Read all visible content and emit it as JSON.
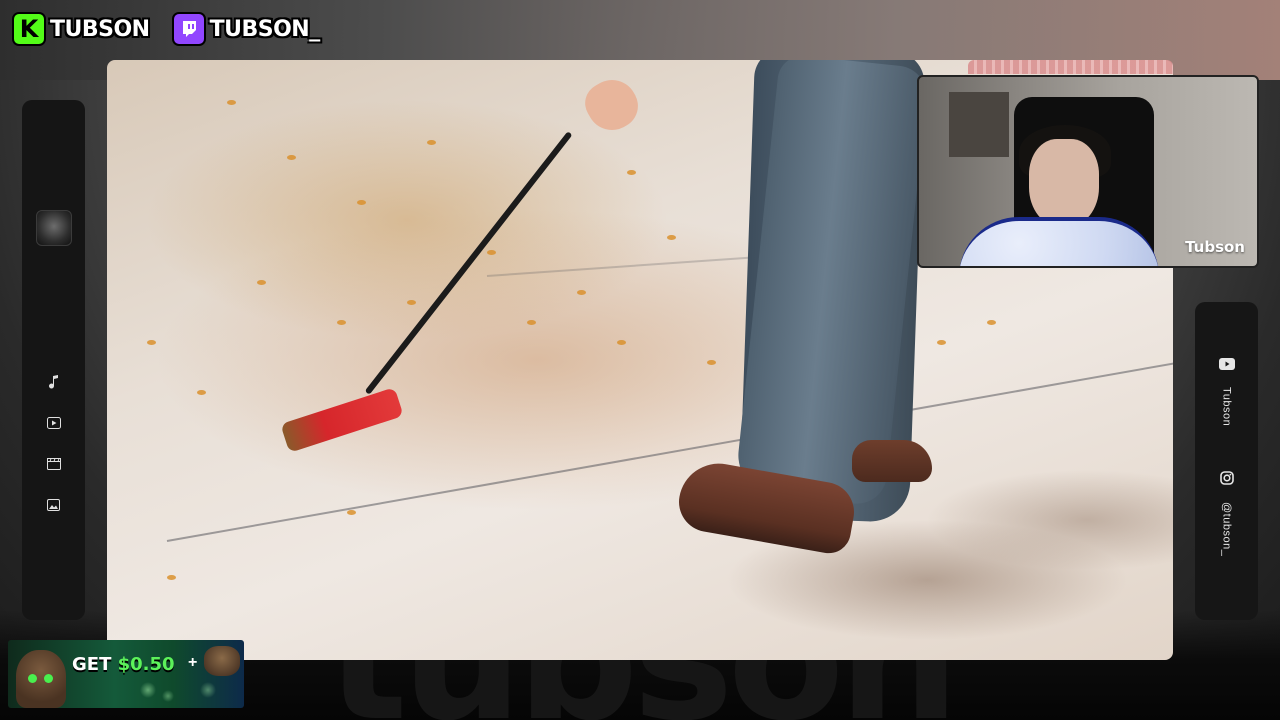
{
  "social_badges": [
    {
      "platform": "Kick",
      "icon": "kick-icon",
      "glyph": "K",
      "handle": "TUBSON",
      "color": "#53fc18"
    },
    {
      "platform": "Twitch",
      "icon": "twitch-icon",
      "glyph": "",
      "handle": "TUBSON_",
      "color": "#9146ff"
    }
  ],
  "left_sidebar": {
    "icons": [
      "music-note-icon",
      "play-video-icon",
      "film-clapper-icon",
      "image-icon"
    ]
  },
  "webcam": {
    "name_label": "Tubson"
  },
  "right_panel": {
    "youtube_icon": "youtube-icon",
    "youtube_handle": "Tubson",
    "instagram_icon": "instagram-icon",
    "instagram_handle": "@tubson_"
  },
  "promo": {
    "prefix": "GET ",
    "amount": "$0.50",
    "plus": "+"
  },
  "watermark": "tubson"
}
